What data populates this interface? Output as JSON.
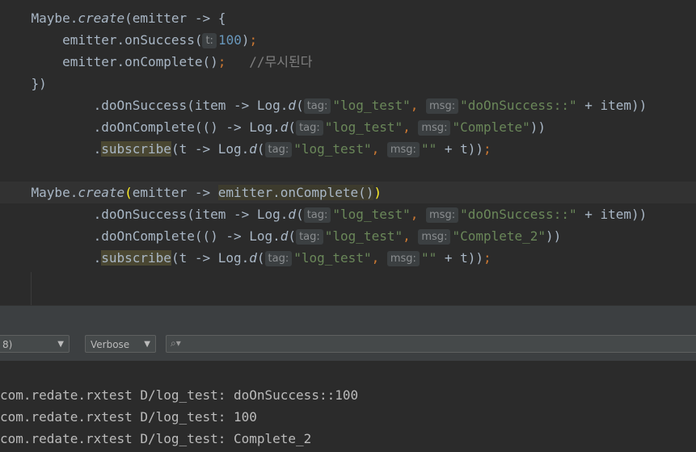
{
  "editor": {
    "lines": [
      {
        "segments": [
          {
            "c": "t-plain",
            "t": "    Maybe."
          },
          {
            "c": "t-italic",
            "t": "create"
          },
          {
            "c": "t-plain",
            "t": "(emitter -> {"
          }
        ]
      },
      {
        "segments": [
          {
            "c": "t-plain",
            "t": "        emitter.onSuccess("
          },
          {
            "hint": "t:"
          },
          {
            "c": "t-num",
            "t": "100"
          },
          {
            "c": "t-plain",
            "t": ")"
          },
          {
            "c": "t-semi",
            "t": ";"
          }
        ]
      },
      {
        "segments": [
          {
            "c": "t-plain",
            "t": "        emitter.onComplete()"
          },
          {
            "c": "t-semi",
            "t": ";"
          },
          {
            "c": "t-plain",
            "t": "   "
          },
          {
            "c": "t-comment",
            "t": "//무시된다"
          }
        ]
      },
      {
        "segments": [
          {
            "c": "t-plain",
            "t": "    })"
          }
        ]
      },
      {
        "segments": [
          {
            "c": "t-plain",
            "t": "            .doOnSuccess(item -> Log."
          },
          {
            "c": "t-italic",
            "t": "d"
          },
          {
            "c": "t-plain",
            "t": "("
          },
          {
            "hint": "tag:"
          },
          {
            "c": "t-str",
            "t": "\"log_test\""
          },
          {
            "c": "t-semi",
            "t": ","
          },
          {
            "c": "t-plain",
            "t": " "
          },
          {
            "hint": "msg:"
          },
          {
            "c": "t-str",
            "t": "\"doOnSuccess::\""
          },
          {
            "c": "t-plain",
            "t": " + item))"
          }
        ]
      },
      {
        "segments": [
          {
            "c": "t-plain",
            "t": "            .doOnComplete(() -> Log."
          },
          {
            "c": "t-italic",
            "t": "d"
          },
          {
            "c": "t-plain",
            "t": "("
          },
          {
            "hint": "tag:"
          },
          {
            "c": "t-str",
            "t": "\"log_test\""
          },
          {
            "c": "t-semi",
            "t": ","
          },
          {
            "c": "t-plain",
            "t": " "
          },
          {
            "hint": "msg:"
          },
          {
            "c": "t-str",
            "t": "\"Complete\""
          },
          {
            "c": "t-plain",
            "t": "))"
          }
        ]
      },
      {
        "segments": [
          {
            "c": "t-plain",
            "t": "            ."
          },
          {
            "c": "t-sub",
            "t": "subscribe"
          },
          {
            "c": "t-plain",
            "t": "(t -> Log."
          },
          {
            "c": "t-italic",
            "t": "d"
          },
          {
            "c": "t-plain",
            "t": "("
          },
          {
            "hint": "tag:"
          },
          {
            "c": "t-str",
            "t": "\"log_test\""
          },
          {
            "c": "t-semi",
            "t": ","
          },
          {
            "c": "t-plain",
            "t": " "
          },
          {
            "hint": "msg:"
          },
          {
            "c": "t-str",
            "t": "\"\""
          },
          {
            "c": "t-plain",
            "t": " + t))"
          },
          {
            "c": "t-semi",
            "t": ";"
          }
        ]
      },
      {
        "segments": []
      },
      {
        "current": true,
        "segments": [
          {
            "c": "t-plain",
            "t": "    Maybe."
          },
          {
            "c": "t-italic",
            "t": "create"
          },
          {
            "c": "t-paren",
            "t": "("
          },
          {
            "c": "t-plain",
            "t": "emitter -> "
          },
          {
            "c": "t-hl",
            "t": "emitter.onComplete()"
          },
          {
            "c": "t-paren",
            "t": ")"
          }
        ]
      },
      {
        "segments": [
          {
            "c": "t-plain",
            "t": "            .doOnSuccess(item -> Log."
          },
          {
            "c": "t-italic",
            "t": "d"
          },
          {
            "c": "t-plain",
            "t": "("
          },
          {
            "hint": "tag:"
          },
          {
            "c": "t-str",
            "t": "\"log_test\""
          },
          {
            "c": "t-semi",
            "t": ","
          },
          {
            "c": "t-plain",
            "t": " "
          },
          {
            "hint": "msg:"
          },
          {
            "c": "t-str",
            "t": "\"doOnSuccess::\""
          },
          {
            "c": "t-plain",
            "t": " + item))"
          }
        ]
      },
      {
        "segments": [
          {
            "c": "t-plain",
            "t": "            .doOnComplete(() -> Log."
          },
          {
            "c": "t-italic",
            "t": "d"
          },
          {
            "c": "t-plain",
            "t": "("
          },
          {
            "hint": "tag:"
          },
          {
            "c": "t-str",
            "t": "\"log_test\""
          },
          {
            "c": "t-semi",
            "t": ","
          },
          {
            "c": "t-plain",
            "t": " "
          },
          {
            "hint": "msg:"
          },
          {
            "c": "t-str",
            "t": "\"Complete_2\""
          },
          {
            "c": "t-plain",
            "t": "))"
          }
        ]
      },
      {
        "segments": [
          {
            "c": "t-plain",
            "t": "            ."
          },
          {
            "c": "t-sub",
            "t": "subscribe"
          },
          {
            "c": "t-plain",
            "t": "(t -> Log."
          },
          {
            "c": "t-italic",
            "t": "d"
          },
          {
            "c": "t-plain",
            "t": "("
          },
          {
            "hint": "tag:"
          },
          {
            "c": "t-str",
            "t": "\"log_test\""
          },
          {
            "c": "t-semi",
            "t": ","
          },
          {
            "c": "t-plain",
            "t": " "
          },
          {
            "hint": "msg:"
          },
          {
            "c": "t-str",
            "t": "\"\""
          },
          {
            "c": "t-plain",
            "t": " + t))"
          },
          {
            "c": "t-semi",
            "t": ";"
          }
        ]
      }
    ]
  },
  "toolbar": {
    "process_select": "8)",
    "level_select": "Verbose",
    "search_icon": "search-icon",
    "search_placeholder": ""
  },
  "log": {
    "lines": [
      "com.redate.rxtest D/log_test: doOnSuccess::100",
      "com.redate.rxtest D/log_test: 100",
      "com.redate.rxtest D/log_test: Complete_2"
    ]
  },
  "colors": {
    "background": "#2b2b2b",
    "string": "#6a8759",
    "number": "#6897bb",
    "keyword": "#cc7832",
    "comment": "#808080",
    "panel": "#3c3f41"
  }
}
